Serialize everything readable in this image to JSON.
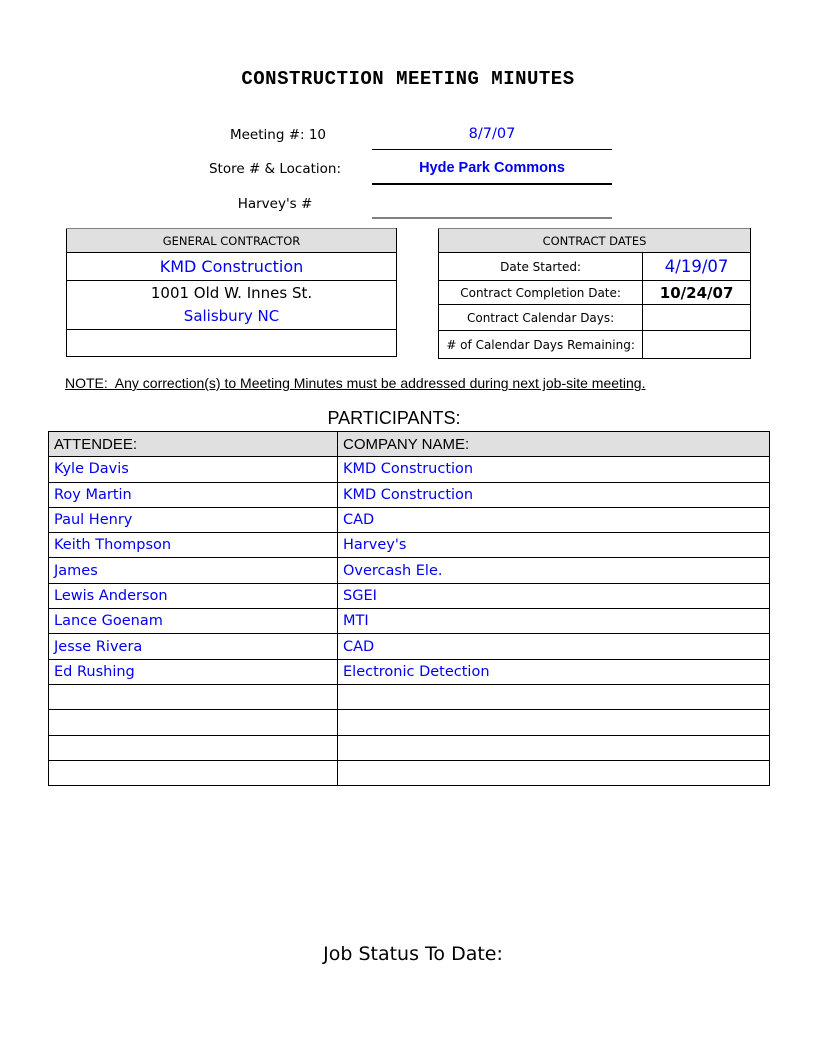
{
  "document": {
    "title": "CONSTRUCTION MEETING MINUTES"
  },
  "meeting_info": {
    "meeting_number_label": "Meeting #: 10",
    "meeting_date": "8/7/07",
    "store_location_label": "Store # & Location:",
    "store_location_value": "Hyde Park Commons",
    "harveys_number_label": "Harvey's #",
    "harveys_number_value": ""
  },
  "general_contractor": {
    "header": "GENERAL CONTRACTOR",
    "company": "KMD Construction",
    "address_line1": "1001 Old W. Innes St.",
    "address_line2": "Salisbury NC",
    "extra": ""
  },
  "contract_dates": {
    "header": "CONTRACT DATES",
    "rows": [
      {
        "label": "Date Started:",
        "value": "4/19/07"
      },
      {
        "label": "Contract Completion Date:",
        "value": "10/24/07"
      },
      {
        "label": "Contract Calendar Days:",
        "value": ""
      },
      {
        "label": "# of Calendar Days Remaining:",
        "value": ""
      }
    ]
  },
  "note": "NOTE:  Any correction(s) to Meeting Minutes must be addressed during next job-site meeting.",
  "participants": {
    "title": "PARTICIPANTS:",
    "columns": [
      "ATTENDEE:",
      "COMPANY NAME:"
    ],
    "rows": [
      {
        "attendee": "Kyle Davis",
        "company": "KMD Construction"
      },
      {
        "attendee": "Roy Martin",
        "company": "KMD Construction"
      },
      {
        "attendee": "Paul Henry",
        "company": "CAD"
      },
      {
        "attendee": "Keith Thompson",
        "company": "Harvey's"
      },
      {
        "attendee": "James",
        "company": "Overcash Ele."
      },
      {
        "attendee": "Lewis Anderson",
        "company": "SGEI"
      },
      {
        "attendee": "Lance Goenam",
        "company": "MTI"
      },
      {
        "attendee": "Jesse Rivera",
        "company": "CAD"
      },
      {
        "attendee": "Ed Rushing",
        "company": "Electronic Detection"
      },
      {
        "attendee": "",
        "company": ""
      },
      {
        "attendee": "",
        "company": ""
      },
      {
        "attendee": "",
        "company": ""
      },
      {
        "attendee": "",
        "company": ""
      }
    ]
  },
  "job_status": {
    "heading": "Job Status To Date:"
  },
  "colors": {
    "value_text": "#0000ee",
    "header_fill": "#e0e0e0"
  }
}
